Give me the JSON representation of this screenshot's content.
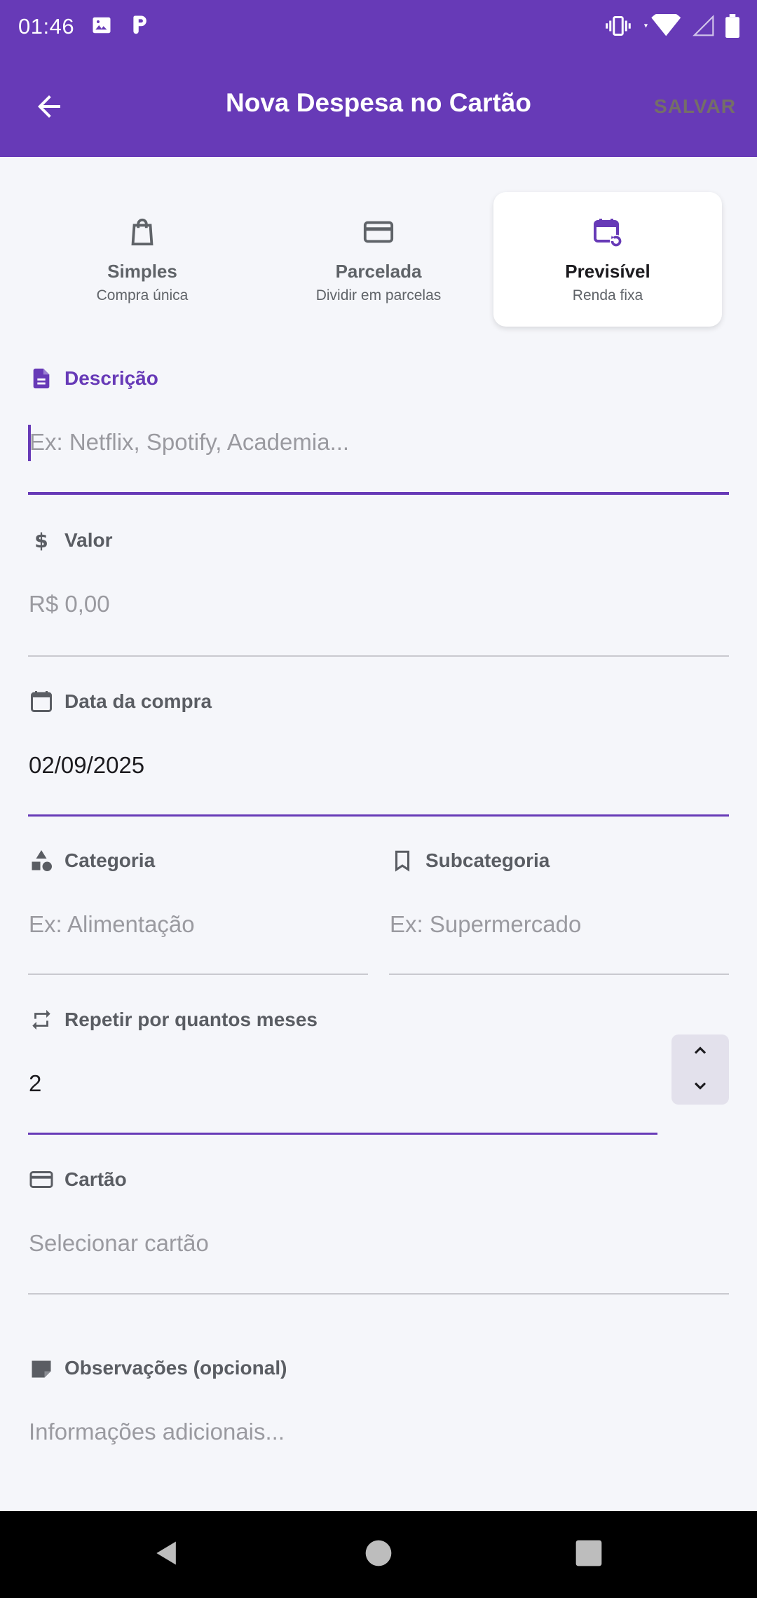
{
  "status_bar": {
    "time": "01:46",
    "left_icons": [
      "image-icon",
      "p-app-icon"
    ],
    "right_icons": [
      "vibrate-icon",
      "wifi-icon",
      "signal-icon",
      "battery-icon"
    ]
  },
  "app_bar": {
    "title": "Nova Despesa no Cartão",
    "save_label": "SALVAR",
    "back_icon": "arrow-back-icon"
  },
  "expense_types": [
    {
      "title": "Simples",
      "subtitle": "Compra única",
      "icon": "shopping-bag-icon",
      "selected": false
    },
    {
      "title": "Parcelada",
      "subtitle": "Dividir em parcelas",
      "icon": "credit-card-icon",
      "selected": false
    },
    {
      "title": "Previsível",
      "subtitle": "Renda fixa",
      "icon": "calendar-repeat-icon",
      "selected": true
    }
  ],
  "form": {
    "descricao": {
      "label": "Descrição",
      "placeholder": "Ex: Netflix, Spotify, Academia...",
      "value": ""
    },
    "valor": {
      "label": "Valor",
      "placeholder": "R$ 0,00",
      "value": ""
    },
    "data_compra": {
      "label": "Data da compra",
      "value": "02/09/2025"
    },
    "categoria": {
      "label": "Categoria",
      "placeholder": "Ex: Alimentação",
      "value": ""
    },
    "subcategoria": {
      "label": "Subcategoria",
      "placeholder": "Ex: Supermercado",
      "value": ""
    },
    "repetir_meses": {
      "label": "Repetir por quantos meses",
      "value": "2"
    },
    "cartao": {
      "label": "Cartão",
      "placeholder": "Selecionar cartão",
      "value": ""
    },
    "observacoes": {
      "label": "Observações (opcional)",
      "placeholder": "Informações adicionais...",
      "value": ""
    }
  },
  "colors": {
    "primary": "#673ab7",
    "background": "#f5f6fa",
    "label": "#5a5d63",
    "placeholder": "#9a9aa0"
  },
  "nav_bar": {
    "buttons": [
      "back-triangle-icon",
      "home-circle-icon",
      "recents-square-icon"
    ]
  }
}
